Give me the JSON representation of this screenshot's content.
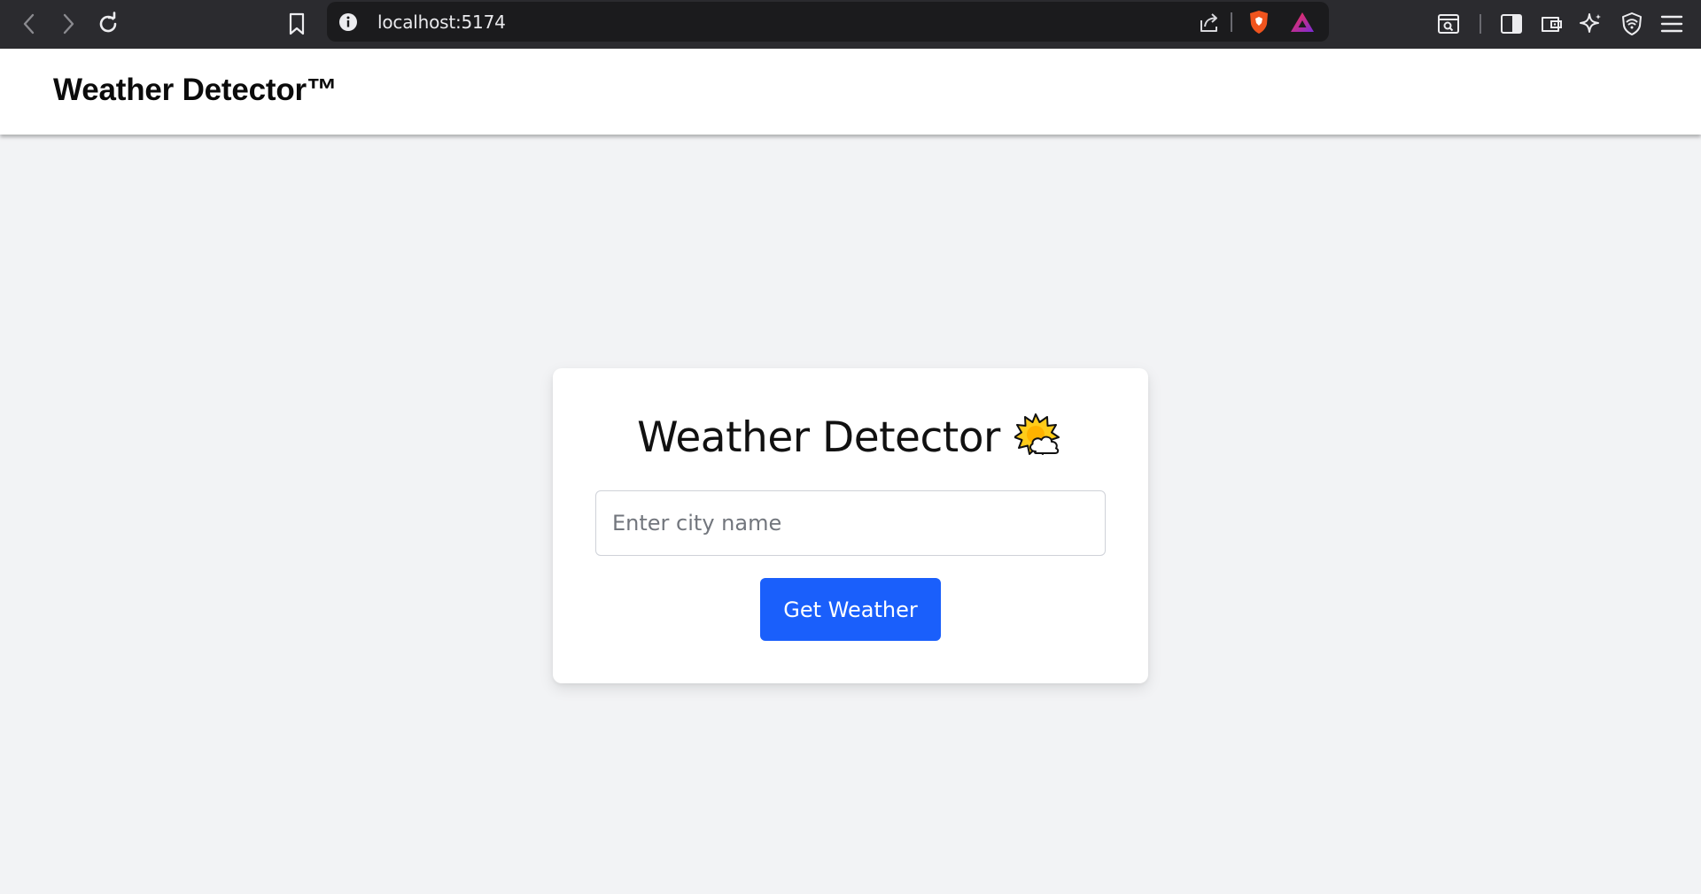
{
  "browser": {
    "url": "localhost:5174",
    "icons": [
      "back-icon",
      "forward-icon",
      "reload-icon",
      "bookmark-icon",
      "site-info-icon",
      "share-icon",
      "brave-shields-icon",
      "brave-rewards-icon",
      "search-tab-icon",
      "sidebar-icon",
      "wallet-icon",
      "leo-ai-icon",
      "vpn-icon",
      "menu-icon"
    ]
  },
  "header": {
    "brand": "Weather Detector™"
  },
  "card": {
    "title": "Weather Detector",
    "title_icon": "sun-behind-cloud-icon",
    "input": {
      "placeholder": "Enter city name",
      "value": ""
    },
    "button_label": "Get Weather"
  },
  "colors": {
    "accent": "#1a5ffb",
    "page_bg": "#f2f3f5",
    "chrome_bg": "#2b2b2f"
  }
}
